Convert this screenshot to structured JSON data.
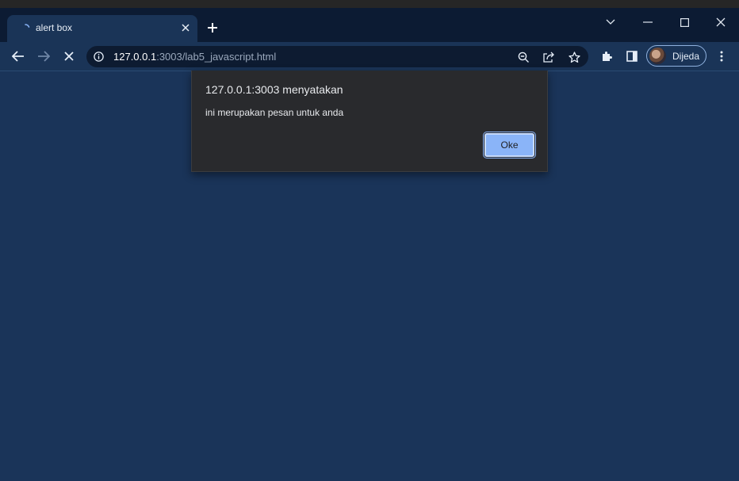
{
  "tab": {
    "title": "alert box",
    "close_icon": "close-icon"
  },
  "new_tab": {
    "label": "+"
  },
  "window_controls": [
    "chevron-down-icon",
    "minimize-icon",
    "maximize-icon",
    "close-icon"
  ],
  "address_bar": {
    "host": "127.0.0.1",
    "rest": ":3003/lab5_javascript.html"
  },
  "profile": {
    "name": "Dijeda"
  },
  "dialog": {
    "origin": "127.0.0.1:3003 menyatakan",
    "message": "ini merupakan pesan untuk anda",
    "ok_label": "Oke"
  },
  "colors": {
    "tabbar_bg": "#0c1b33",
    "toolbar_bg": "#1a3457",
    "page_bg": "#1a3459",
    "dialog_bg": "#292a2d",
    "accent": "#8ab4f8"
  }
}
